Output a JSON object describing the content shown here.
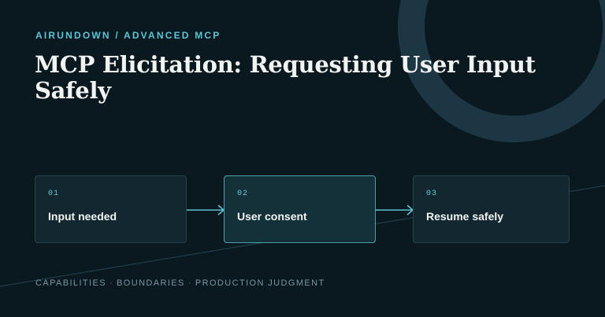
{
  "header": {
    "eyebrow": "AIRUNDOWN / ADVANCED MCP",
    "title": "MCP Elicitation: Requesting User Input Safely"
  },
  "steps": [
    {
      "number": "01",
      "label": "Input needed",
      "active": false
    },
    {
      "number": "02",
      "label": "User consent",
      "active": true
    },
    {
      "number": "03",
      "label": "Resume safely",
      "active": false
    }
  ],
  "footer": {
    "items": [
      "CAPABILITIES",
      "BOUNDARIES",
      "PRODUCTION JUDGMENT"
    ],
    "separator": "·"
  },
  "colors": {
    "background": "#0a1820",
    "accent": "#5cc4d6",
    "ring": "#1c3643",
    "card": "#12272f",
    "card_active": "#14313a",
    "arrow": "#5fc3d3"
  }
}
